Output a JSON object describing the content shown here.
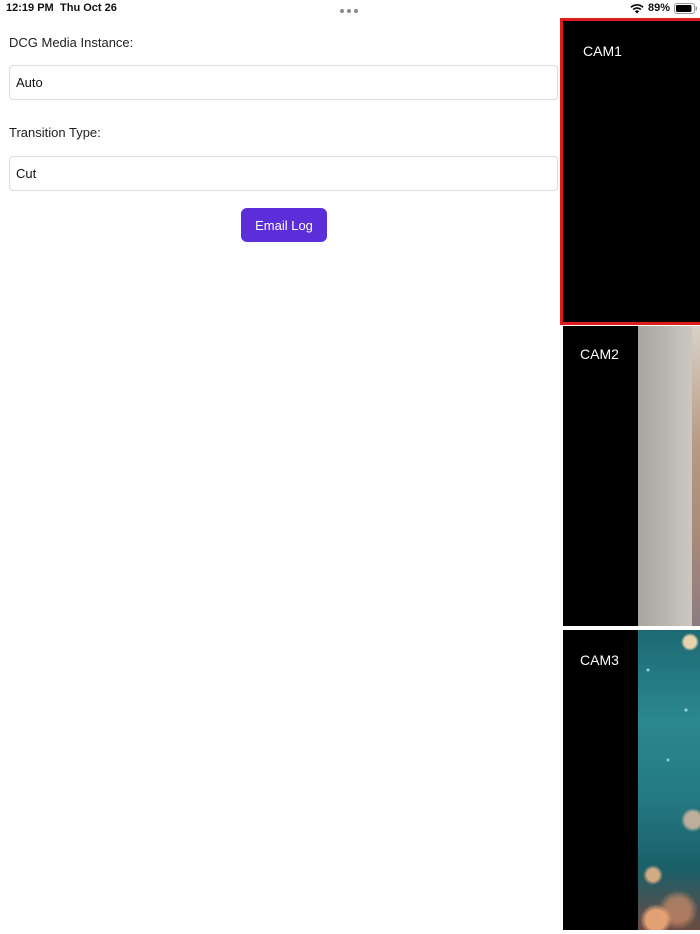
{
  "status_bar": {
    "time": "12:19 PM",
    "date": "Thu Oct 26",
    "battery_percent": "89%"
  },
  "form": {
    "media_instance": {
      "label": "DCG Media Instance:",
      "value": "Auto"
    },
    "transition_type": {
      "label": "Transition Type:",
      "value": "Cut"
    },
    "email_log_label": "Email Log"
  },
  "cameras": [
    {
      "label": "CAM1",
      "selected": true
    },
    {
      "label": "CAM2",
      "selected": false
    },
    {
      "label": "CAM3",
      "selected": false
    }
  ],
  "colors": {
    "accent": "#5b2ed9",
    "selected_border": "#e01b1b"
  }
}
